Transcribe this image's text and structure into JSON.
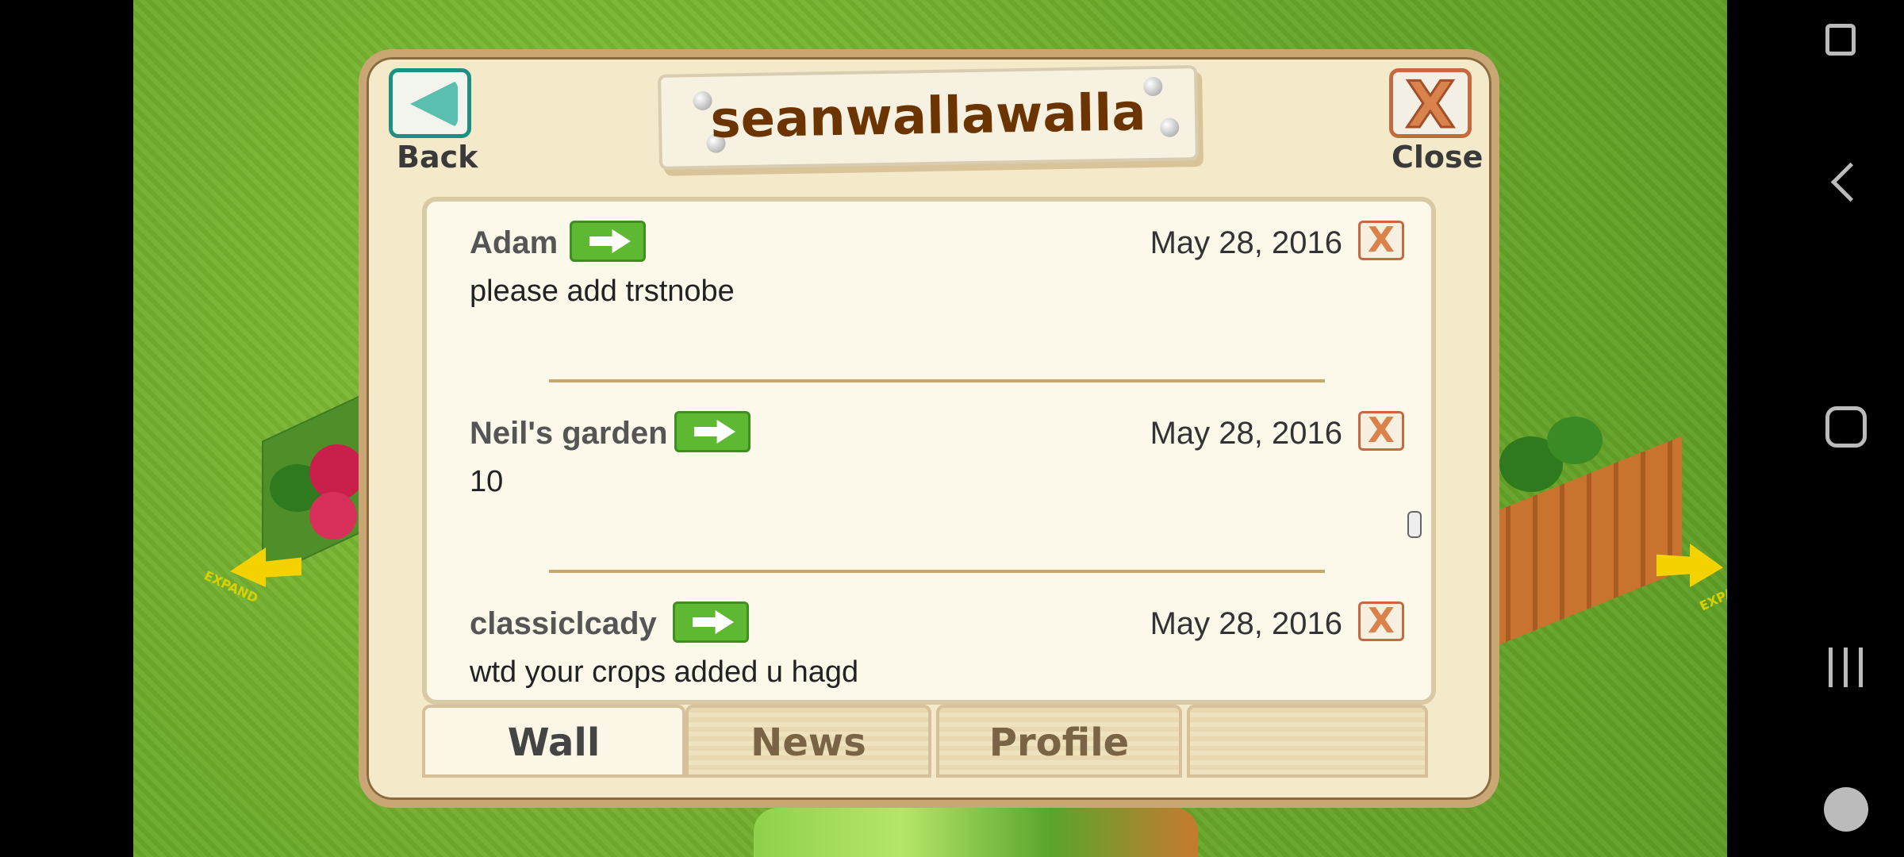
{
  "dialog": {
    "title": "seanwallawalla",
    "back_label": "Back",
    "close_label": "Close"
  },
  "wall": {
    "posts": [
      {
        "author": "Adam",
        "date": "May 28, 2016",
        "message": "please add trstnobe"
      },
      {
        "author": "Neil's garden",
        "date": "May 28, 2016",
        "message": "10"
      },
      {
        "author": "classiclcady",
        "date": "May 28, 2016",
        "message": "wtd your crops added u hagd"
      }
    ]
  },
  "tabs": [
    {
      "label": "Wall",
      "active": true
    },
    {
      "label": "News",
      "active": false
    },
    {
      "label": "Profile",
      "active": false
    },
    {
      "label": "",
      "active": false
    }
  ],
  "scene": {
    "expand_label": "EXPAND"
  },
  "icons": {
    "delete": "X",
    "go": "arrow-right-icon"
  }
}
